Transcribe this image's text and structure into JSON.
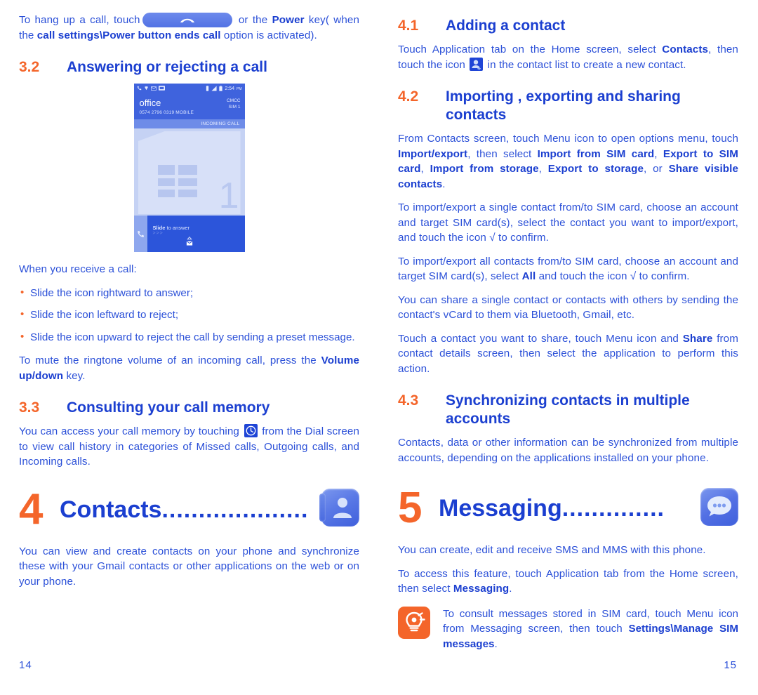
{
  "document": {
    "left_page_number": "14",
    "right_page_number": "15"
  },
  "colors": {
    "body_blue": "#2b50d8",
    "heading_blue": "#1b3fd0",
    "accent_orange": "#f4652a",
    "phone_ui_blue": "#3f63dd"
  },
  "left_column": {
    "intro_paragraph": {
      "part1": "To hang up a call, touch",
      "pill_icon": "hangup-call-icon",
      "part2": " or the ",
      "bold1": "Power",
      "part3": " key( when the ",
      "bold2": "call settings\\Power button ends call",
      "part4": " option is activated)."
    },
    "section_3_2": {
      "number": "3.2",
      "title": "Answering or rejecting a call"
    },
    "phone_screenshot": {
      "status_bar": {
        "left_icons": [
          "phone-icon",
          "wifi-icon",
          "mail-icon",
          "sim-icon"
        ],
        "right_icons": [
          "vibrate-icon",
          "signal-icon",
          "battery-icon"
        ],
        "time": "2:54",
        "meridiem": "PM"
      },
      "caller_name": "office",
      "caller_number": "0574 2796 0319 MOBILE",
      "sim_operator": "CMCC",
      "sim_slot": "SIM 1",
      "call_state": "INCOMING CALL",
      "wallpaper_digit": "1",
      "answer_bar": {
        "handle_icon": "phone-handset-icon",
        "label_bold": "Slide",
        "label_rest": " to answer",
        "arrows": ">>>",
        "message_icon": "envelope-up-icon"
      }
    },
    "when_receive": "When you receive a call:",
    "bullets": [
      "Slide the icon rightward to answer;",
      "Slide the icon leftward to reject;",
      "Slide the icon upward to reject the call by sending a preset message."
    ],
    "mute_paragraph": {
      "part1": "To mute the ringtone volume of an incoming call, press the ",
      "bold1": "Volume up/down",
      "part2": " key."
    },
    "section_3_3": {
      "number": "3.3",
      "title": "Consulting your call memory"
    },
    "call_memory_paragraph": {
      "part1": "You can access your call memory by touching",
      "inline_icon": "call-history-clock-icon",
      "part2": "from the Dial screen to view call history in categories of Missed calls, Outgoing calls, and Incoming calls."
    },
    "chapter_4": {
      "number": "4",
      "title": "Contacts",
      "dots": "....................",
      "icon": "contacts-app-icon"
    },
    "chapter_4_intro": "You can view and create contacts on your phone and synchronize these with your Gmail contacts or other applications on the web or on your phone."
  },
  "right_column": {
    "section_4_1": {
      "number": "4.1",
      "title": "Adding a contact"
    },
    "adding_contact_paragraph": {
      "part1": "Touch Application tab on the Home screen, select ",
      "bold1": "Contacts",
      "part2": ", then touch the icon",
      "inline_icon": "add-contact-icon",
      "part3": "in the contact list to create a new contact."
    },
    "section_4_2": {
      "number": "4.2",
      "title": "Importing , exporting and sharing contacts"
    },
    "import_export_paragraph": {
      "part1": "From Contacts screen, touch Menu icon to open options menu, touch ",
      "bold1": "Import/export",
      "part2": ", then select ",
      "bold2": "Import from SIM card",
      "part3": ", ",
      "bold3": "Export to SIM card",
      "part4": ", ",
      "bold4": "Import from storage",
      "part5": ", ",
      "bold5": "Export to storage",
      "part6": ", or ",
      "bold6": "Share visible contacts",
      "part7": "."
    },
    "single_contact_paragraph": "To import/export a single contact from/to SIM card, choose an account and target SIM card(s), select the contact you want to import/export, and touch the icon √ to confirm.",
    "all_contacts_paragraph": {
      "part1": "To import/export all contacts from/to SIM card, choose an account and target SIM card(s), select ",
      "bold1": "All",
      "part2": " and touch the icon √ to confirm."
    },
    "share_vcard_paragraph": "You can share a single contact or contacts with others by sending the contact's vCard to them via Bluetooth, Gmail, etc.",
    "share_menu_paragraph": {
      "part1": "Touch a contact you want to share, touch Menu icon and ",
      "bold1": "Share",
      "part2": " from contact details screen, then select the application to perform this action."
    },
    "section_4_3": {
      "number": "4.3",
      "title": "Synchronizing contacts in multiple accounts"
    },
    "sync_paragraph": "Contacts, data or other information can be synchronized from multiple accounts, depending on the applications installed on your phone.",
    "chapter_5": {
      "number": "5",
      "title": "Messaging",
      "dots": "..............",
      "icon": "messaging-app-icon"
    },
    "messaging_intro_1": "You can create, edit and receive SMS and MMS with this phone.",
    "messaging_intro_2": {
      "part1": "To access this feature, touch Application tab from the Home screen, then select ",
      "bold1": "Messaging",
      "part2": "."
    },
    "tip": {
      "icon": "lightbulb-tip-icon",
      "part1": "To consult messages stored in SIM card, touch Menu icon from Messaging screen, then touch ",
      "bold1": "Settings\\Manage SIM messages",
      "part2": "."
    }
  }
}
